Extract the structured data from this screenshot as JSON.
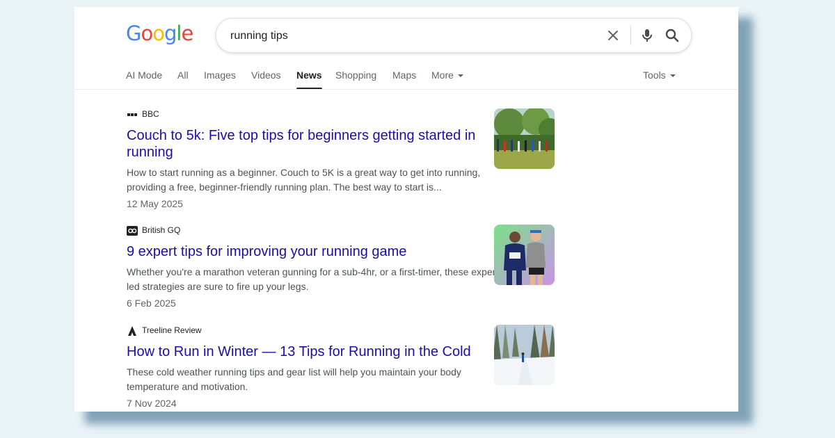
{
  "logo": {
    "text": "Google"
  },
  "search": {
    "query": "running tips"
  },
  "tabs": [
    {
      "label": "AI Mode",
      "active": false
    },
    {
      "label": "All",
      "active": false
    },
    {
      "label": "Images",
      "active": false
    },
    {
      "label": "Videos",
      "active": false
    },
    {
      "label": "News",
      "active": true
    },
    {
      "label": "Shopping",
      "active": false
    },
    {
      "label": "Maps",
      "active": false
    },
    {
      "label": "More",
      "active": false
    }
  ],
  "tools": {
    "label": "Tools"
  },
  "results": [
    {
      "source": "BBC",
      "title_line1": "Couch to 5k: Five top tips for beginners getting started in",
      "title_line2": "running",
      "snippet_line1": "How to start running as a beginner. Couch to 5K is a great way to get into running,",
      "snippet_line2": "providing a free, beginner-friendly running plan. The best way to start is...",
      "date": "12 May 2025",
      "source_icon": "bbc-logo-icon"
    },
    {
      "source": "British GQ",
      "title_line1": "9 expert tips for improving your running game",
      "title_line2": "",
      "snippet_line1": "Whether you're a marathon veteran gunning for a sub-4hr, or a first-timer, these expert-",
      "snippet_line2": "led strategies are sure to fire up your legs.",
      "date": "6 Feb 2025",
      "source_icon": "gq-logo-icon"
    },
    {
      "source": "Treeline Review",
      "title_line1": "How to Run in Winter — 13 Tips for Running in the Cold",
      "title_line2": "",
      "snippet_line1": "These cold weather running tips and gear list will help you maintain your body",
      "snippet_line2": "temperature and motivation.",
      "date": "7 Nov 2024",
      "source_icon": "treeline-logo-icon"
    }
  ],
  "colors": {
    "link": "#1a0dab",
    "google_blue": "#4285F4",
    "google_red": "#EA4335",
    "google_yellow": "#FBBC05",
    "google_green": "#34A853"
  }
}
